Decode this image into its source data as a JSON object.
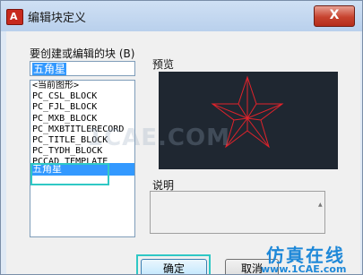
{
  "window": {
    "title": "编辑块定义",
    "close_label": "X",
    "app_icon_glyph": "A",
    "app_icon_color": "#c72a1e"
  },
  "form": {
    "block_label": "要创建或编辑的块 (B)",
    "block_value": "五角星",
    "preview_label": "预览",
    "description_label": "说明"
  },
  "block_list": {
    "items": [
      "<当前图形>",
      "PC_CSL_BLOCK",
      "PC_FJL_BLOCK",
      "PC_MXB_BLOCK",
      "PC_MXBTITLERECORD",
      "PC_TITLE_BLOCK",
      "PC_TYDH_BLOCK",
      "PCCAD_TEMPLATE",
      "五角星"
    ],
    "selected": "五角星"
  },
  "buttons": {
    "ok_label": "确定",
    "cancel_label": "取消"
  },
  "preview": {
    "background": "#1f2731",
    "shape_color": "#e0232b",
    "shape": "five-pointed star"
  },
  "watermark": {
    "text": "1CAE.COM",
    "site_name": "仿真在线",
    "site_url": "www.1CAE.com"
  },
  "highlight_color": "#2fc8c5"
}
